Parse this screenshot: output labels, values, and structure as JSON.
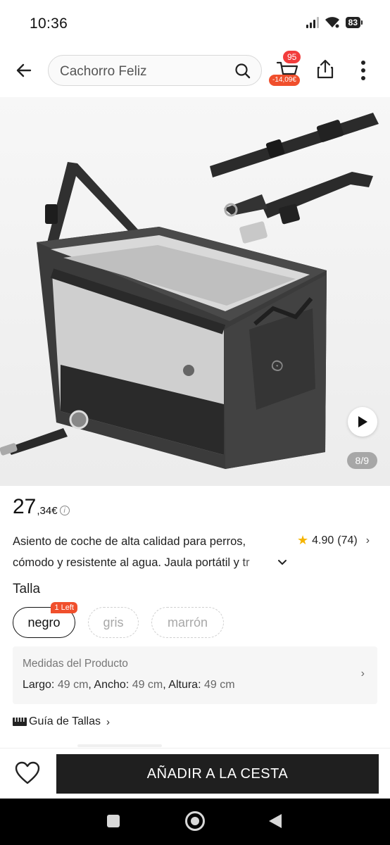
{
  "status_bar": {
    "time": "10:36",
    "battery": "83"
  },
  "header": {
    "search_text": "Cachorro Feliz",
    "cart_count": "95",
    "cart_discount": "-14,09€"
  },
  "gallery": {
    "counter": "8/9"
  },
  "product": {
    "price_int": "27",
    "price_dec": ",34€",
    "title_line1": "Asiento de coche de alta calidad para perros,",
    "title_line2": "cómodo y resistente al agua. Jaula portátil y tr",
    "rating": "4.90",
    "reviews": "(74)"
  },
  "size": {
    "label": "Talla",
    "options": [
      {
        "label": "negro",
        "badge": "1 Left",
        "state": "selected"
      },
      {
        "label": "gris",
        "state": "disabled"
      },
      {
        "label": "marrón",
        "state": "disabled"
      }
    ]
  },
  "measurements": {
    "title": "Medidas del Producto",
    "largo_label": "Largo:",
    "largo": "49 cm",
    "ancho_label": "Ancho:",
    "ancho": "49 cm",
    "altura_label": "Altura:",
    "altura": "49 cm"
  },
  "size_guide": {
    "label": "Guía de Tallas"
  },
  "actions": {
    "add_to_cart": "AÑADIR A LA CESTA"
  },
  "icons": {
    "back": "arrow-left-icon",
    "search": "search-icon",
    "cart": "cart-icon",
    "share": "share-icon",
    "more": "more-vertical-icon",
    "play": "play-icon",
    "star": "star-icon",
    "heart": "heart-icon"
  },
  "colors": {
    "accent": "#f04f2c",
    "cart_badge": "#f23c3c",
    "star": "#f5b400",
    "cta": "#1f1f1f"
  }
}
